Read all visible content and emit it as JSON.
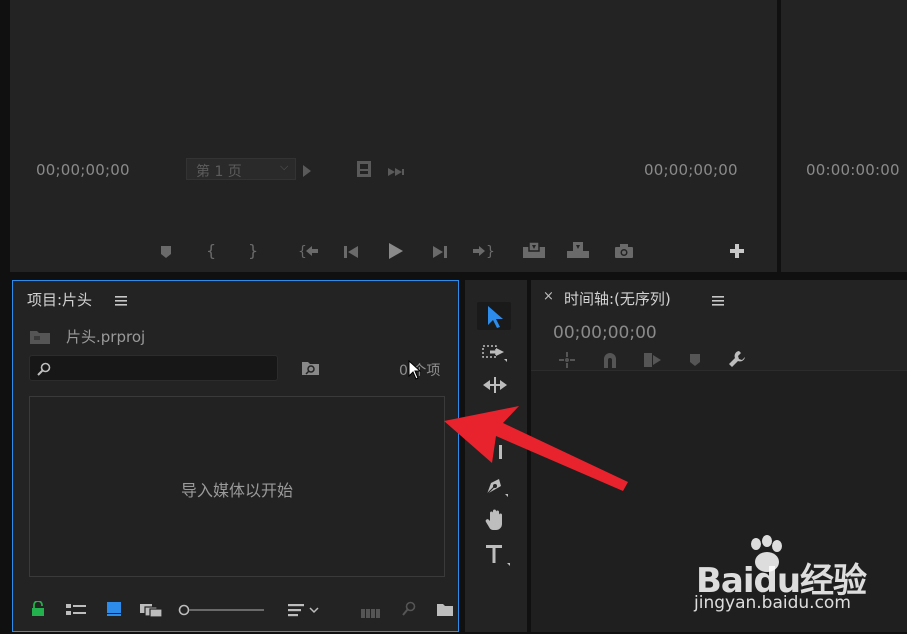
{
  "source_monitor": {
    "timecode_left": "00;00;00;00",
    "timecode_right": "00;00;00;00",
    "page_selector": "第 1 页"
  },
  "program_monitor": {
    "timecode": "00:00:00:00"
  },
  "project_panel": {
    "title": "项目:片头",
    "project_file": "片头.prproj",
    "search_placeholder": "",
    "item_count": "0 个项",
    "empty_message": "导入媒体以开始"
  },
  "timeline_panel": {
    "close_glyph": "×",
    "title": "时间轴:(无序列)",
    "timecode": "00;00;00;00"
  },
  "watermark": {
    "brand": "Baidu经验",
    "url": "jingyan.baidu.com"
  },
  "colors": {
    "accent_blue": "#2d8ceb",
    "lock_green": "#22b14c",
    "annotation_red": "#e8232d",
    "panel_bg": "#232323",
    "app_bg": "#101010"
  }
}
